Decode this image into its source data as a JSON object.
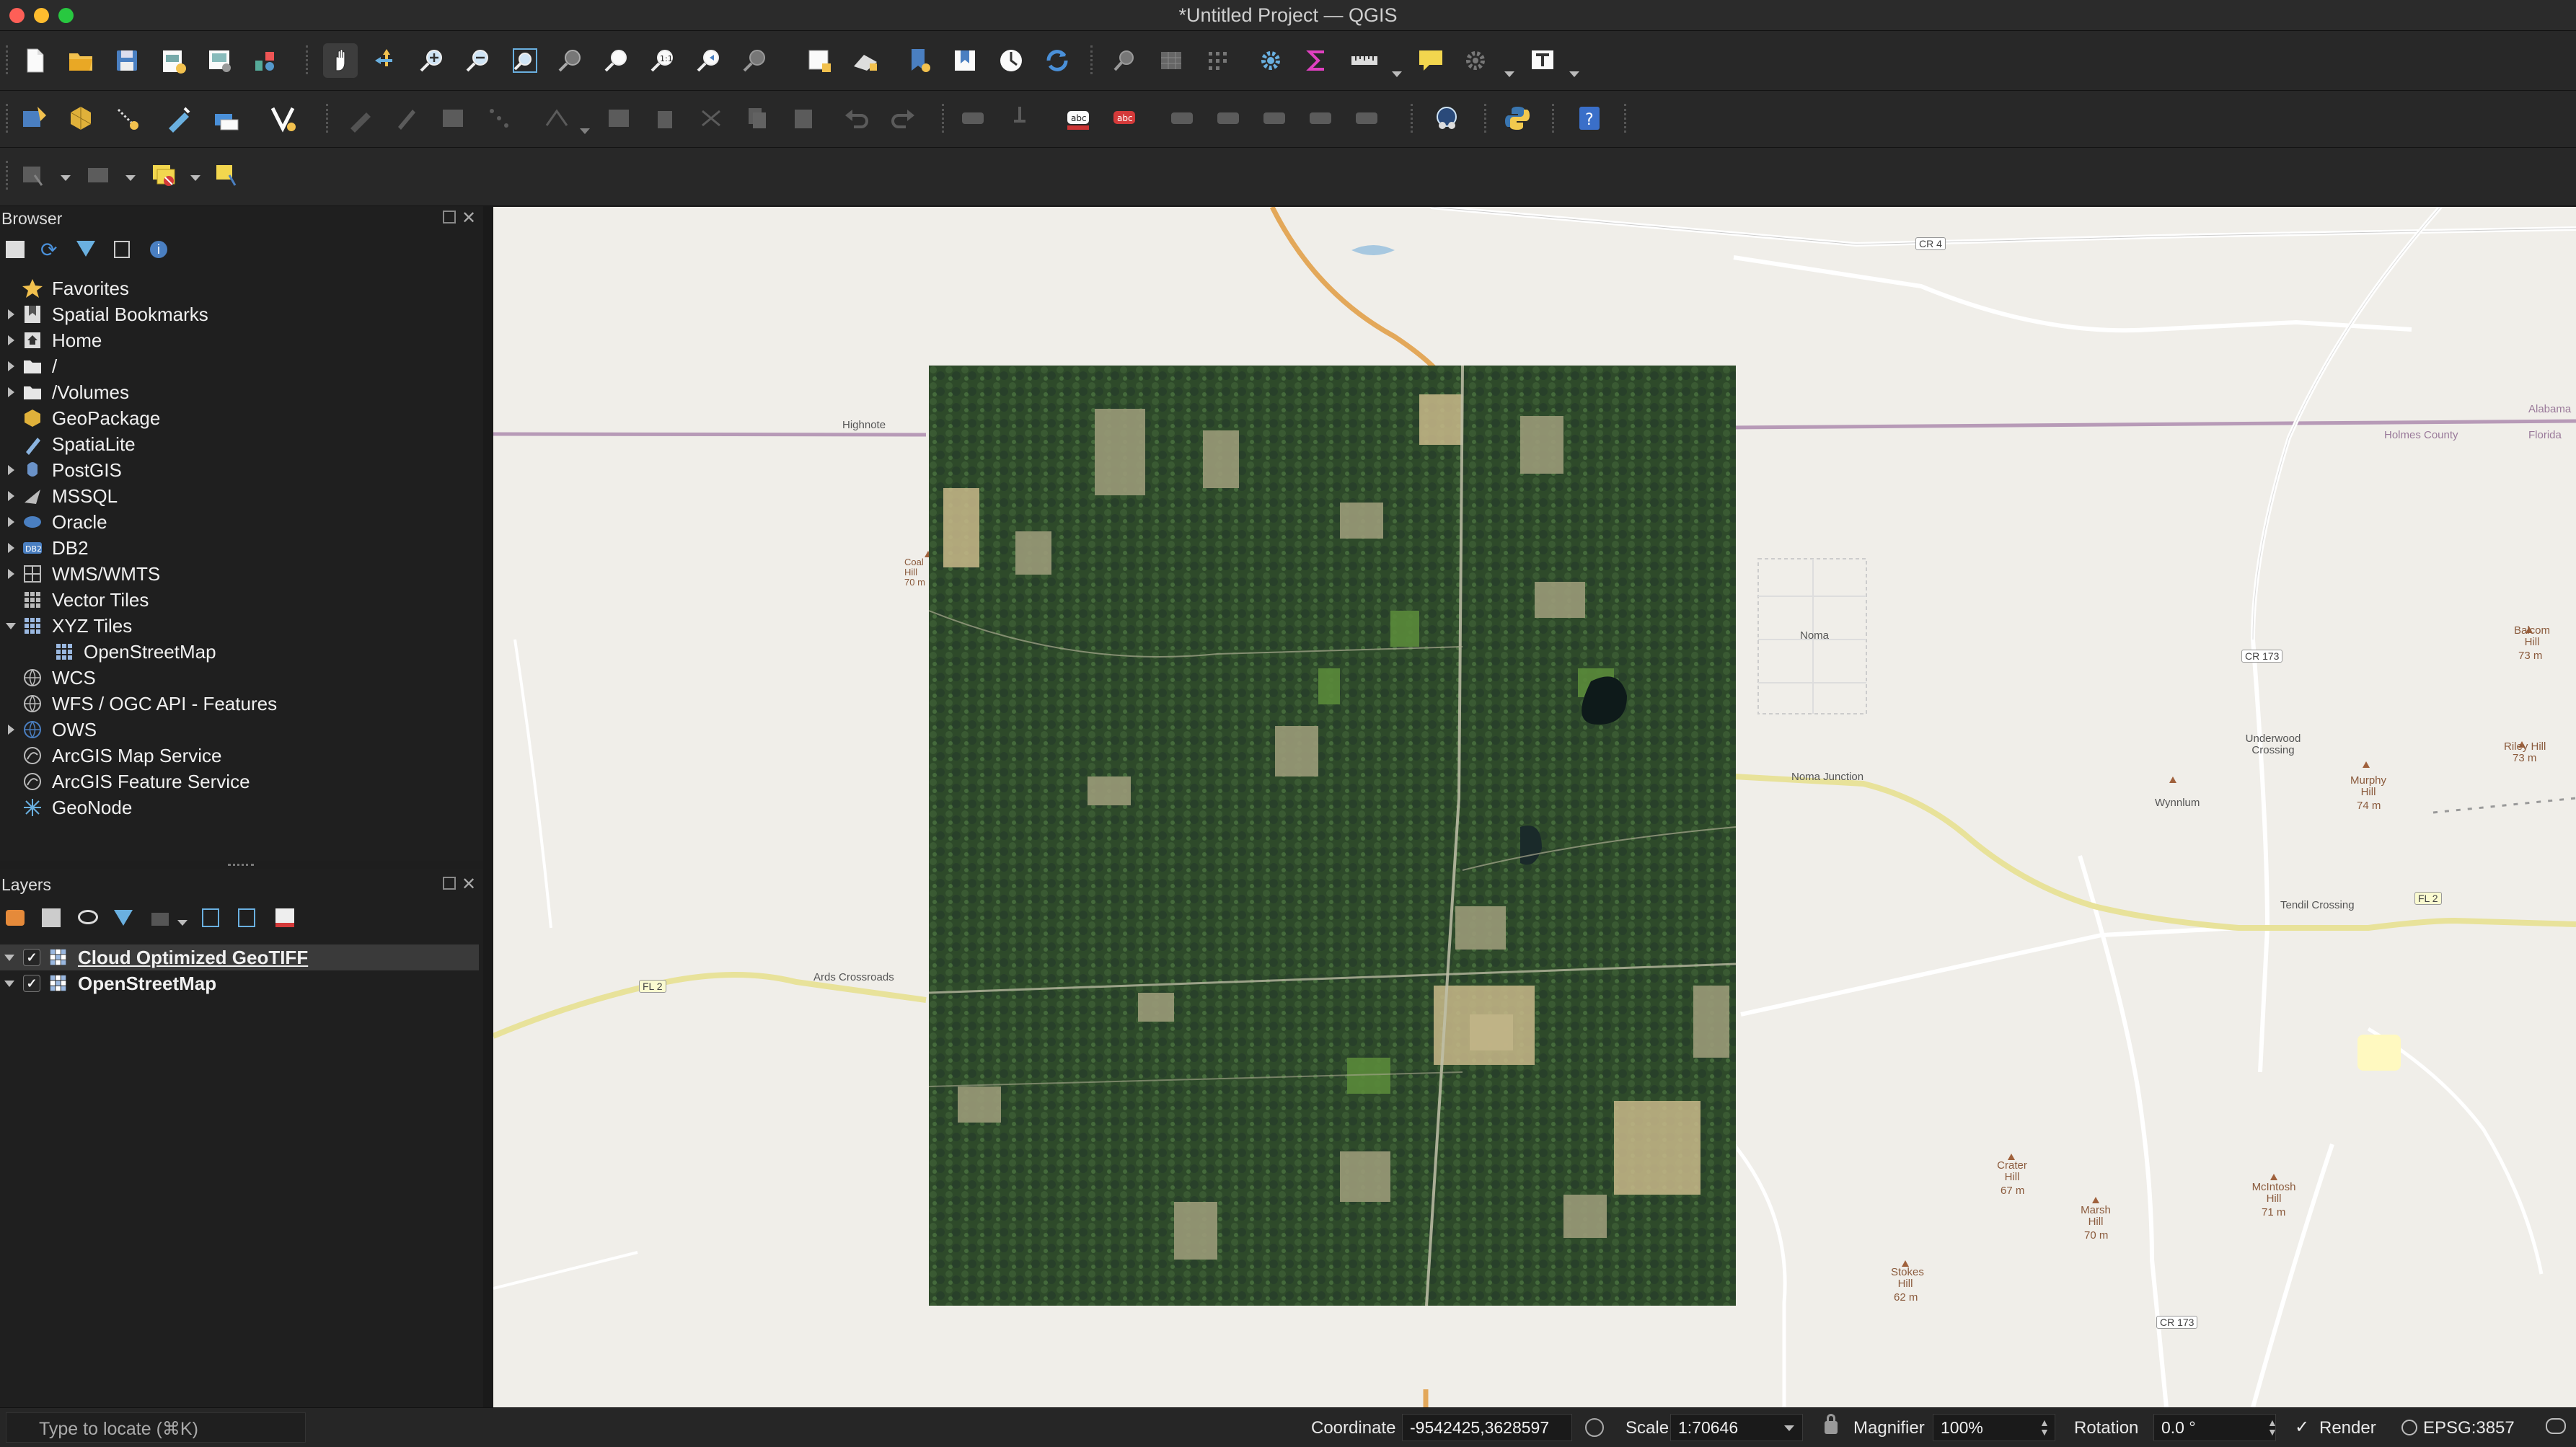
{
  "window": {
    "title": "*Untitled Project — QGIS"
  },
  "browser": {
    "title": "Browser",
    "items": [
      {
        "label": "Favorites",
        "icon": "star-icon",
        "expandable": false
      },
      {
        "label": "Spatial Bookmarks",
        "icon": "bookmark-icon",
        "expandable": true
      },
      {
        "label": "Home",
        "icon": "home-folder-icon",
        "expandable": true
      },
      {
        "label": "/",
        "icon": "folder-icon",
        "expandable": true
      },
      {
        "label": "/Volumes",
        "icon": "folder-icon",
        "expandable": true
      },
      {
        "label": "GeoPackage",
        "icon": "geopackage-icon",
        "expandable": false
      },
      {
        "label": "SpatiaLite",
        "icon": "spatialite-icon",
        "expandable": false
      },
      {
        "label": "PostGIS",
        "icon": "postgis-icon",
        "expandable": true
      },
      {
        "label": "MSSQL",
        "icon": "mssql-icon",
        "expandable": true
      },
      {
        "label": "Oracle",
        "icon": "oracle-icon",
        "expandable": true
      },
      {
        "label": "DB2",
        "icon": "db2-icon",
        "expandable": true
      },
      {
        "label": "WMS/WMTS",
        "icon": "wms-icon",
        "expandable": true
      },
      {
        "label": "Vector Tiles",
        "icon": "vector-tiles-icon",
        "expandable": false
      },
      {
        "label": "XYZ Tiles",
        "icon": "xyz-tiles-icon",
        "expandable": true,
        "expanded": true
      },
      {
        "label": "OpenStreetMap",
        "icon": "xyz-tiles-icon",
        "child": true
      },
      {
        "label": "WCS",
        "icon": "wcs-icon",
        "expandable": false
      },
      {
        "label": "WFS / OGC API - Features",
        "icon": "wfs-icon",
        "expandable": false
      },
      {
        "label": "OWS",
        "icon": "ows-icon",
        "expandable": true
      },
      {
        "label": "ArcGIS Map Service",
        "icon": "arcgis-icon",
        "expandable": false
      },
      {
        "label": "ArcGIS Feature Service",
        "icon": "arcgis-icon",
        "expandable": false
      },
      {
        "label": "GeoNode",
        "icon": "geonode-icon",
        "expandable": false
      }
    ]
  },
  "layers": {
    "title": "Layers",
    "items": [
      {
        "label": "Cloud Optimized GeoTIFF",
        "checked": true,
        "selected": true
      },
      {
        "label": "OpenStreetMap",
        "checked": true,
        "selected": false
      }
    ]
  },
  "map_labels": {
    "highnote": "Highnote",
    "coal_hill": "Coal Hill 70 m",
    "noma": "Noma",
    "noma_junction": "Noma Junction",
    "holmes_county": "Holmes County",
    "alabama": "Alabama",
    "florida": "Florida",
    "ards_crossroads": "Ards Crossroads",
    "underwood_crossing": "Underwood Crossing",
    "wynnlum": "Wynnlum",
    "murphy_hill": "Murphy Hill",
    "murphy_hill_elev": "74 m",
    "balcom_hill": "Balcom Hill",
    "balcom_hill_elev": "73 m",
    "riley_hill": "Riley Hill",
    "riley_hill_elev": "73 m",
    "tendil_crossing": "Tendil Crossing",
    "crater_hill": "Crater Hill",
    "crater_hill_elev": "67 m",
    "marsh_hill": "Marsh Hill",
    "marsh_hill_elev": "70 m",
    "mcintosh_hill": "McIntosh Hill",
    "mcintosh_hill_elev": "71 m",
    "stokes_hill": "Stokes Hill",
    "stokes_hill_elev": "62 m",
    "cr4": "CR 4",
    "cr173a": "CR 173",
    "cr173b": "CR 173",
    "fl2a": "FL 2",
    "fl2b": "FL 2"
  },
  "statusbar": {
    "locate_placeholder": "Type to locate (⌘K)",
    "coordinate_label": "Coordinate",
    "coordinate_value": "-9542425,3628597",
    "scale_label": "Scale",
    "scale_value": "1:70646",
    "magnifier_label": "Magnifier",
    "magnifier_value": "100%",
    "rotation_label": "Rotation",
    "rotation_value": "0.0 °",
    "render_label": "Render",
    "render_checked": true,
    "crs_label": "EPSG:3857"
  },
  "colors": {
    "accent_selected": "#3a3a3a",
    "map_background": "#f0eee9",
    "boundary": "#b79ab7",
    "highway": "#e8e29a",
    "orange_road": "#e3a85a"
  }
}
